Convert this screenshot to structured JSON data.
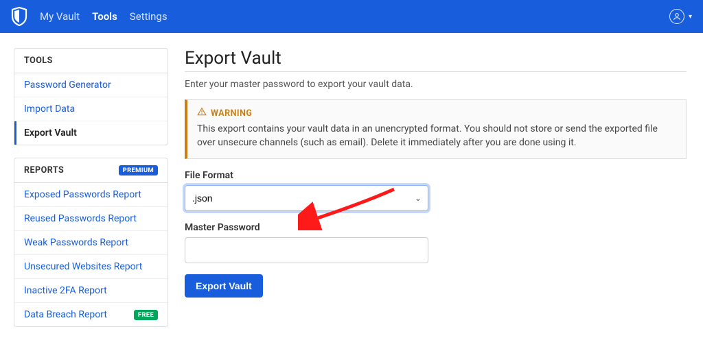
{
  "nav": {
    "items": [
      "My Vault",
      "Tools",
      "Settings"
    ],
    "active_index": 1
  },
  "sidebar": {
    "groups": [
      {
        "title": "TOOLS",
        "badge": null,
        "items": [
          {
            "label": "Password Generator",
            "active": false
          },
          {
            "label": "Import Data",
            "active": false
          },
          {
            "label": "Export Vault",
            "active": true
          }
        ]
      },
      {
        "title": "REPORTS",
        "badge": "PREMIUM",
        "items": [
          {
            "label": "Exposed Passwords Report"
          },
          {
            "label": "Reused Passwords Report"
          },
          {
            "label": "Weak Passwords Report"
          },
          {
            "label": "Unsecured Websites Report"
          },
          {
            "label": "Inactive 2FA Report"
          },
          {
            "label": "Data Breach Report",
            "badge": "FREE"
          }
        ]
      }
    ]
  },
  "page": {
    "title": "Export Vault",
    "subtitle": "Enter your master password to export your vault data."
  },
  "warning": {
    "heading": "WARNING",
    "body": "This export contains your vault data in an unencrypted format. You should not store or send the exported file over unsecure channels (such as email). Delete it immediately after you are done using it."
  },
  "form": {
    "file_format_label": "File Format",
    "file_format_value": ".json",
    "master_password_label": "Master Password",
    "master_password_value": "",
    "submit_label": "Export Vault"
  },
  "colors": {
    "primary": "#175ddc",
    "warning": "#c97f15",
    "success": "#00a65a"
  }
}
